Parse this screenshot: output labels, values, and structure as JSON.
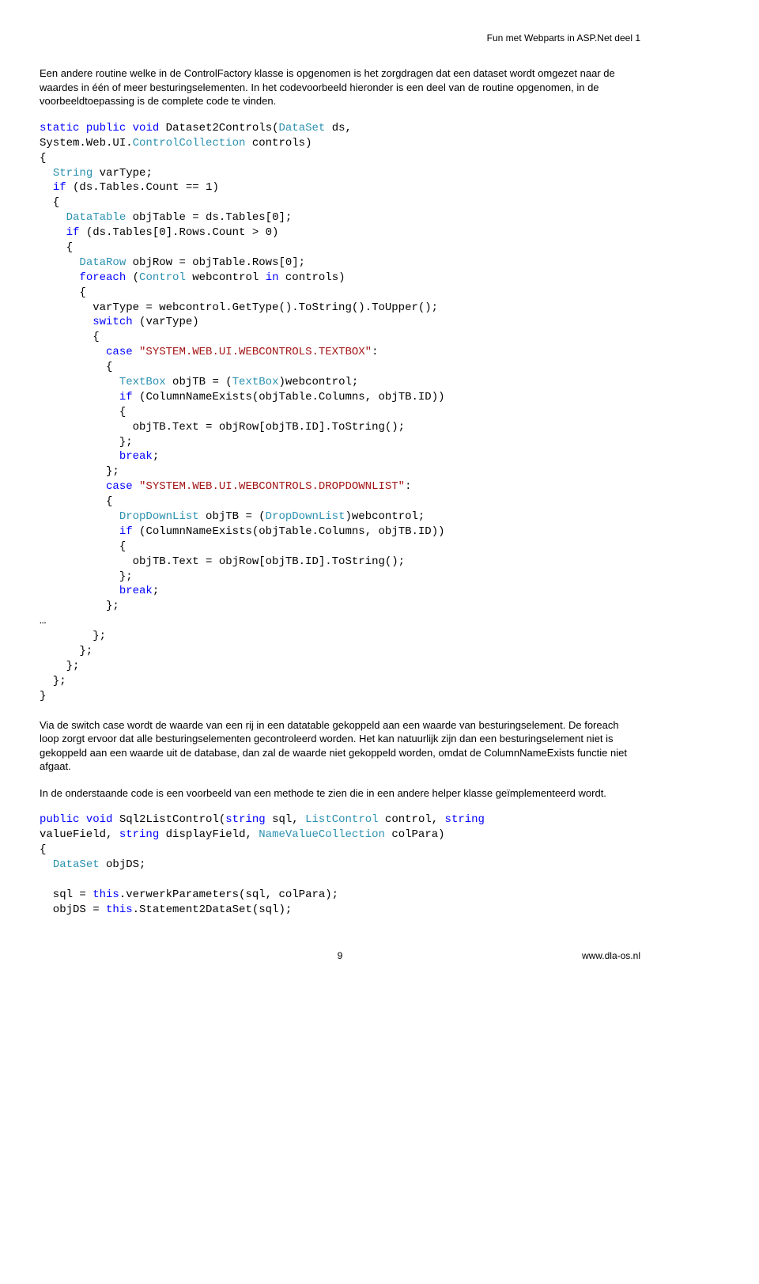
{
  "header": {
    "title": "Fun met Webparts in ASP.Net deel 1"
  },
  "para1": "Een andere routine welke in de ControlFactory klasse is opgenomen is het zorgdragen dat een dataset wordt omgezet naar de waardes in één of meer besturingselementen. In het codevoorbeeld hieronder is een deel van de routine opgenomen, in de voorbeeldtoepassing is de complete code te vinden.",
  "code1": {
    "l1a": "static",
    "l1b": "public",
    "l1c": "void",
    "l1d": " Dataset2Controls(",
    "l1e": "DataSet",
    "l1f": " ds,",
    "l2a": "System.Web.UI.",
    "l2b": "ControlCollection",
    "l2c": " controls)",
    "l3": "{",
    "l4a": "String",
    "l4b": " varType;",
    "l5a": "if",
    "l5b": " (ds.Tables.Count == 1)",
    "l6": "  {",
    "l7a": "DataTable",
    "l7b": " objTable = ds.Tables[0];",
    "l8a": "if",
    "l8b": " (ds.Tables[0].Rows.Count > 0)",
    "l9": "    {",
    "l10a": "DataRow",
    "l10b": " objRow = objTable.Rows[0];",
    "l11a": "foreach",
    "l11b": " (",
    "l11c": "Control",
    "l11d": " webcontrol ",
    "l11e": "in",
    "l11f": " controls)",
    "l12": "      {",
    "l13": "        varType = webcontrol.GetType().ToString().ToUpper();",
    "l14a": "switch",
    "l14b": " (varType)",
    "l15": "        {",
    "l16a": "case",
    "l16b": "\"SYSTEM.WEB.UI.WEBCONTROLS.TEXTBOX\"",
    "l16c": ":",
    "l17": "          {",
    "l18a": "TextBox",
    "l18b": " objTB = (",
    "l18c": "TextBox",
    "l18d": ")webcontrol;",
    "l19a": "if",
    "l19b": " (ColumnNameExists(objTable.Columns, objTB.ID))",
    "l20": "            {",
    "l21": "              objTB.Text = objRow[objTB.ID].ToString();",
    "l22": "            };",
    "l23a": "break",
    "l23b": ";",
    "l24": "          };",
    "l25a": "case",
    "l25b": "\"SYSTEM.WEB.UI.WEBCONTROLS.DROPDOWNLIST\"",
    "l25c": ":",
    "l26": "          {",
    "l27a": "DropDownList",
    "l27b": " objTB = (",
    "l27c": "DropDownList",
    "l27d": ")webcontrol;",
    "l28a": "if",
    "l28b": " (ColumnNameExists(objTable.Columns, objTB.ID))",
    "l29": "            {",
    "l30": "              objTB.Text = objRow[objTB.ID].ToString();",
    "l31": "            };",
    "l32a": "break",
    "l32b": ";",
    "l33": "          };",
    "l34": "…",
    "l35": "        };",
    "l36": "      };",
    "l37": "    };",
    "l38": "  };",
    "l39": "}"
  },
  "para2": "Via de switch case wordt de waarde van een rij in een datatable gekoppeld aan een waarde van besturingselement. De foreach loop zorgt ervoor dat alle besturingselementen gecontroleerd worden. Het kan natuurlijk zijn dan een besturingselement niet is gekoppeld aan een waarde uit de database, dan zal de waarde niet gekoppeld worden, omdat de ColumnNameExists functie niet afgaat.",
  "para3": "In de onderstaande code is een voorbeeld van een methode te zien die in een andere helper klasse geïmplementeerd wordt.",
  "code2": {
    "l1a": "public",
    "l1b": "void",
    "l1c": " Sql2ListControl(",
    "l1d": "string",
    "l1e": " sql, ",
    "l1f": "ListControl",
    "l1g": " control, ",
    "l1h": "string",
    "l2a": "valueField, ",
    "l2b": "string",
    "l2c": " displayField, ",
    "l2d": "NameValueCollection",
    "l2e": " colPara)",
    "l3": "{",
    "l4a": "DataSet",
    "l4b": " objDS;",
    "l5": "",
    "l6a": "  sql = ",
    "l6b": "this",
    "l6c": ".verwerkParameters(sql, colPara);",
    "l7a": "  objDS = ",
    "l7b": "this",
    "l7c": ".Statement2DataSet(sql);"
  },
  "footer": {
    "page": "9",
    "url": "www.dla-os.nl"
  }
}
